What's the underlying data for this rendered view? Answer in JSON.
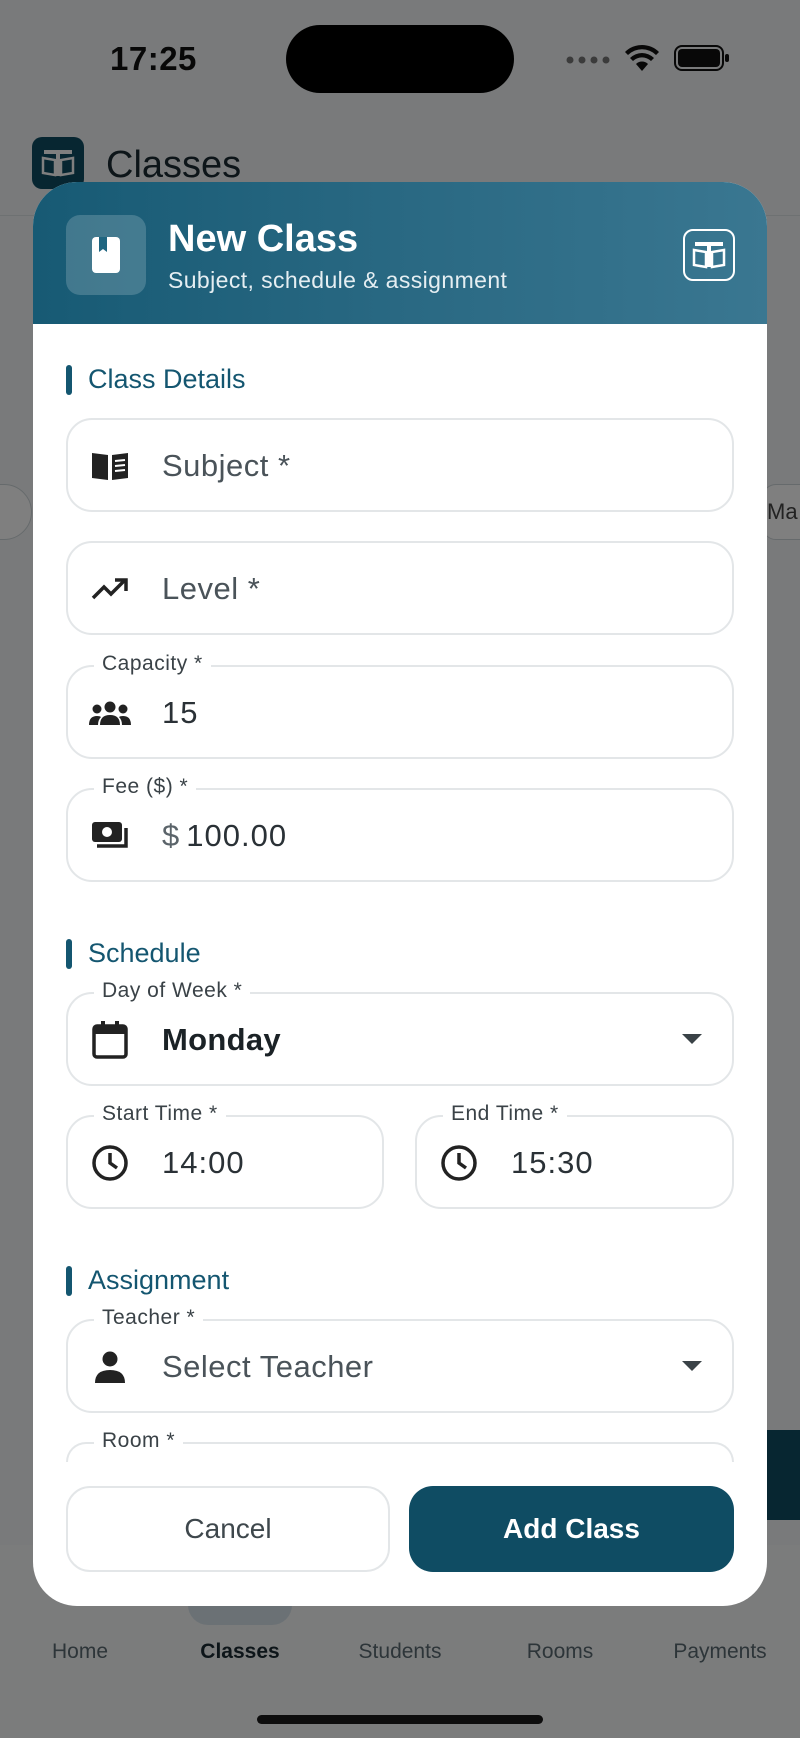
{
  "status_bar": {
    "time": "17:25"
  },
  "app": {
    "title": "Classes",
    "side_chip_text": "Ma",
    "nav": [
      {
        "label": "Home"
      },
      {
        "label": "Classes"
      },
      {
        "label": "Students"
      },
      {
        "label": "Rooms"
      },
      {
        "label": "Payments"
      }
    ]
  },
  "dialog": {
    "title": "New Class",
    "subtitle": "Subject, schedule & assignment",
    "sections": {
      "details": "Class Details",
      "schedule": "Schedule",
      "assignment": "Assignment"
    },
    "fields": {
      "subject": {
        "placeholder": "Subject *",
        "icon": "book-icon"
      },
      "level": {
        "placeholder": "Level *",
        "icon": "trending-up-icon"
      },
      "capacity": {
        "label": "Capacity *",
        "value": "15",
        "icon": "group-icon"
      },
      "fee": {
        "label": "Fee ($) *",
        "prefix": "$",
        "value": "100.00",
        "icon": "money-icon"
      },
      "day": {
        "label": "Day of Week *",
        "value": "Monday",
        "icon": "calendar-icon"
      },
      "start": {
        "label": "Start Time *",
        "value": "14:00",
        "icon": "clock-icon"
      },
      "end": {
        "label": "End Time *",
        "value": "15:30",
        "icon": "clock-icon"
      },
      "teacher": {
        "label": "Teacher *",
        "placeholder": "Select Teacher",
        "icon": "person-icon"
      },
      "room": {
        "label": "Room *"
      }
    },
    "buttons": {
      "cancel": "Cancel",
      "add": "Add Class"
    }
  }
}
